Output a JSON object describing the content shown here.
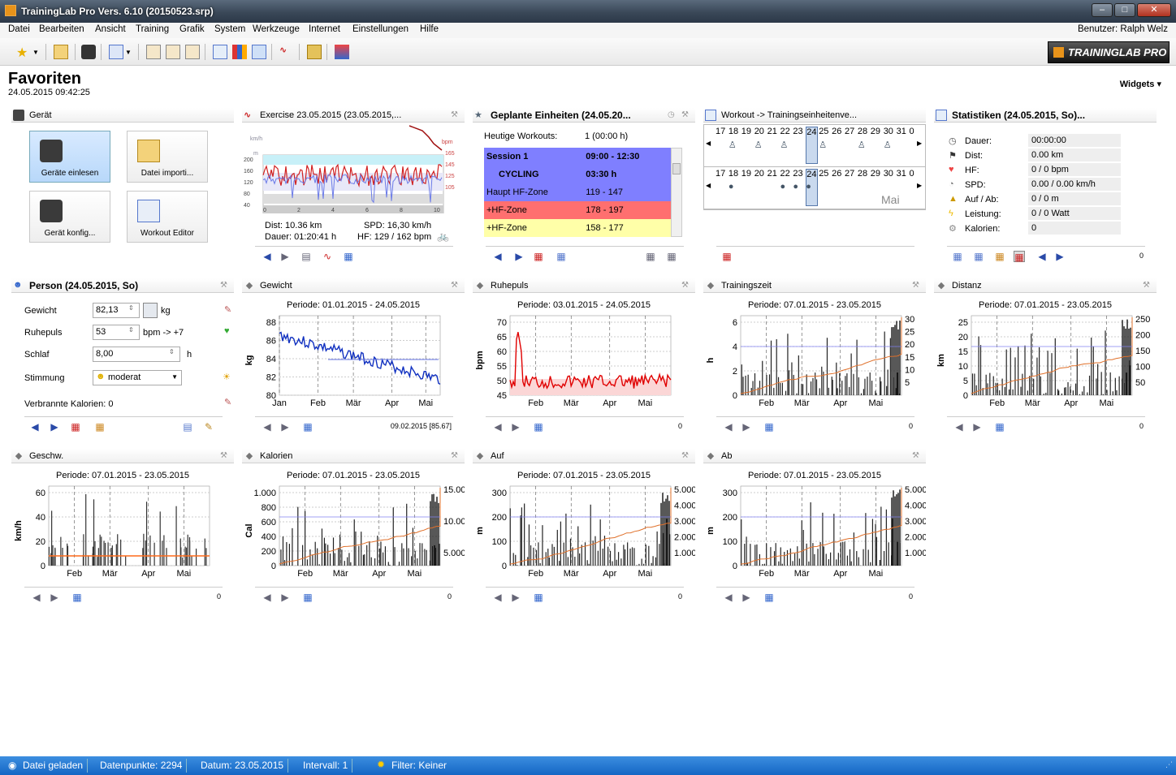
{
  "window": {
    "title": "TrainingLab Pro Vers. 6.10 (20150523.srp)"
  },
  "menu": {
    "items": [
      "Datei",
      "Bearbeiten",
      "Ansicht",
      "Training",
      "Grafik",
      "System",
      "Werkzeuge",
      "Internet",
      "Einstellungen",
      "Hilfe"
    ],
    "user": "Benutzer: Ralph Welz"
  },
  "brand": "TRAININGLAB PRO",
  "page": {
    "title": "Favoriten",
    "datetime": "24.05.2015 09:42:25",
    "widgets": "Widgets"
  },
  "panels": {
    "geraet": {
      "title": "Gerät",
      "buttons": [
        "Geräte einlesen",
        "Datei importi...",
        "Gerät konfig...",
        "Workout Editor"
      ]
    },
    "exercise": {
      "title": "Exercise 23.05.2015 (23.05.2015,...",
      "left_units": [
        "km/h",
        "m"
      ],
      "left_ticks": [
        "200",
        "160",
        "120",
        "80",
        "40",
        "0"
      ],
      "right_unit": "bpm",
      "right_ticks": [
        "165",
        "145",
        "125",
        "105"
      ],
      "x_ticks": [
        "0",
        "2",
        "4",
        "6",
        "8",
        "10"
      ],
      "dist": "Dist: 10.36 km",
      "dauer": "Dauer: 01:20:41 h",
      "spd": "SPD: 16,30 km/h",
      "hf": "HF: 129 / 162 bpm"
    },
    "geplante": {
      "title": "Geplante Einheiten (24.05.20...",
      "heute_label": "Heutige Workouts:",
      "heute_value": "1 (00:00 h)",
      "rows": [
        [
          "Session 1",
          "09:00 - 12:30"
        ],
        [
          "CYCLING",
          "03:30 h"
        ],
        [
          "Haupt HF-Zone",
          "119 - 147"
        ],
        [
          "+HF-Zone",
          "178 - 197"
        ],
        [
          "+HF-Zone",
          "158 - 177"
        ]
      ],
      "row_colors": [
        "#7f7fff",
        "#7f7fff",
        "#7f7fff",
        "#ff6f6f",
        "#ffffa8"
      ]
    },
    "workout": {
      "title": "Workout -> Trainingseinheitenve...",
      "days": [
        "17",
        "18",
        "19",
        "20",
        "21",
        "22",
        "23",
        "24",
        "25",
        "26",
        "27",
        "28",
        "29",
        "30",
        "31",
        "0"
      ],
      "month": "Mai"
    },
    "statistiken": {
      "title": "Statistiken (24.05.2015, So)...",
      "rows": [
        {
          "label": "Dauer:",
          "value": "00:00:00",
          "icon": "stopwatch-icon"
        },
        {
          "label": "Dist:",
          "value": "0.00 km",
          "icon": "flag-icon"
        },
        {
          "label": "HF:",
          "value": "0 / 0 bpm",
          "icon": "heart-icon"
        },
        {
          "label": "SPD:",
          "value": "0.00 / 0.00 km/h",
          "icon": "speedometer-icon"
        },
        {
          "label": "Auf / Ab:",
          "value": "0 / 0 m",
          "icon": "mountain-icon"
        },
        {
          "label": "Leistung:",
          "value": "0 / 0 Watt",
          "icon": "lightning-icon"
        },
        {
          "label": "Kalorien:",
          "value": "0",
          "icon": "gear-icon"
        }
      ],
      "foot_value": "0"
    },
    "person": {
      "title": "Person (24.05.2015, So)",
      "gewicht_label": "Gewicht",
      "gewicht": "82,13",
      "gewicht_unit": "kg",
      "ruhepuls_label": "Ruhepuls",
      "ruhepuls": "53",
      "ruhepuls_unit": "bpm  -> +7",
      "schlaf_label": "Schlaf",
      "schlaf": "8,00",
      "schlaf_unit": "h",
      "stimmung_label": "Stimmung",
      "stimmung": "moderat",
      "kalorien": "Verbrannte Kalorien: 0"
    },
    "gewicht": {
      "title": "Gewicht",
      "periode": "Periode: 01.01.2015 - 24.05.2015",
      "ylabel": "kg",
      "yticks": [
        "88",
        "86",
        "84",
        "82",
        "80"
      ],
      "months": [
        "Jan",
        "Feb",
        "Mär",
        "Apr",
        "Mai"
      ],
      "foot": "09.02.2015 [85.67]"
    },
    "ruhepuls": {
      "title": "Ruhepuls",
      "periode": "Periode: 03.01.2015 - 24.05.2015",
      "ylabel": "bpm",
      "yticks": [
        "70",
        "65",
        "60",
        "55",
        "50",
        "45"
      ],
      "months": [
        "Feb",
        "Mär",
        "Apr",
        "Mai"
      ],
      "foot": "0"
    },
    "trainingszeit": {
      "title": "Trainingszeit",
      "periode": "Periode: 07.01.2015 - 23.05.2015",
      "ylabel": "h",
      "yticks": [
        "6",
        "4",
        "2",
        "0"
      ],
      "rticks": [
        "30",
        "25",
        "20",
        "15",
        "10",
        "5"
      ],
      "months": [
        "Feb",
        "Mär",
        "Apr",
        "Mai"
      ],
      "foot": "0"
    },
    "distanz": {
      "title": "Distanz",
      "periode": "Periode: 07.01.2015 - 23.05.2015",
      "ylabel": "km",
      "yticks": [
        "25",
        "20",
        "15",
        "10",
        "5",
        "0"
      ],
      "rticks": [
        "250",
        "200",
        "150",
        "100",
        "50"
      ],
      "months": [
        "Feb",
        "Mär",
        "Apr",
        "Mai"
      ],
      "foot": "0"
    },
    "geschw": {
      "title": "Geschw.",
      "periode": "Periode: 07.01.2015 - 23.05.2015",
      "ylabel": "km/h",
      "yticks": [
        "60",
        "40",
        "20",
        "0"
      ],
      "months": [
        "Feb",
        "Mär",
        "Apr",
        "Mai"
      ],
      "foot": "0"
    },
    "kalorien": {
      "title": "Kalorien",
      "periode": "Periode: 07.01.2015 - 23.05.2015",
      "ylabel": "Cal",
      "yticks": [
        "1.000",
        "800",
        "600",
        "400",
        "200",
        "0"
      ],
      "rticks": [
        "15.000",
        "10.000",
        "5.000"
      ],
      "months": [
        "Feb",
        "Mär",
        "Apr",
        "Mai"
      ],
      "foot": "0"
    },
    "auf": {
      "title": "Auf",
      "periode": "Periode: 07.01.2015 - 23.05.2015",
      "ylabel": "m",
      "yticks": [
        "300",
        "200",
        "100",
        "0"
      ],
      "rticks": [
        "5.000",
        "4.000",
        "3.000",
        "2.000",
        "1.000"
      ],
      "months": [
        "Feb",
        "Mär",
        "Apr",
        "Mai"
      ],
      "foot": "0"
    },
    "ab": {
      "title": "Ab",
      "periode": "Periode: 07.01.2015 - 23.05.2015",
      "ylabel": "m",
      "yticks": [
        "300",
        "200",
        "100",
        "0"
      ],
      "rticks": [
        "5.000",
        "4.000",
        "3.000",
        "2.000",
        "1.000"
      ],
      "months": [
        "Feb",
        "Mär",
        "Apr",
        "Mai"
      ],
      "foot": "0"
    }
  },
  "status": {
    "loaded": "Datei geladen",
    "points": "Datenpunkte: 2294",
    "date": "Datum: 23.05.2015",
    "interval": "Intervall: 1",
    "filter": "Filter: Keiner"
  }
}
